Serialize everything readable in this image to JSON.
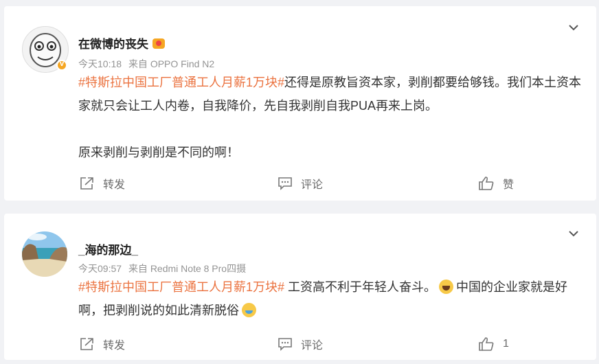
{
  "posts": [
    {
      "author": "在微博的丧失",
      "time": "今天10:18",
      "source": "来自 OPPO Find N2",
      "hashtag": "#特斯拉中国工厂普通工人月薪1万块#",
      "text_line1": "还得是原教旨资本家，剥削都要给够钱。我们本土资本家就只会让工人内卷，自我降价，先自我剥削自我PUA再来上岗。",
      "text_line2": "原来剥削与剥削是不同的啊！",
      "repost_label": "转发",
      "comment_label": "评论",
      "like_label": "赞"
    },
    {
      "author": "_海的那边_",
      "time": "今天09:57",
      "source": "来自 Redmi Note 8 Pro四摄",
      "hashtag": "#特斯拉中国工厂普通工人月薪1万块#",
      "text_a": " 工资高不利于年轻人奋斗。",
      "text_b": "中国的企业家就是好啊，把剥削说的如此清新脱俗",
      "repost_label": "转发",
      "comment_label": "评论",
      "like_label": "1"
    }
  ],
  "icons": {
    "chevron": "chevron-down-icon",
    "repost": "share-icon",
    "comment": "comment-icon",
    "like": "thumbs-up-icon"
  }
}
